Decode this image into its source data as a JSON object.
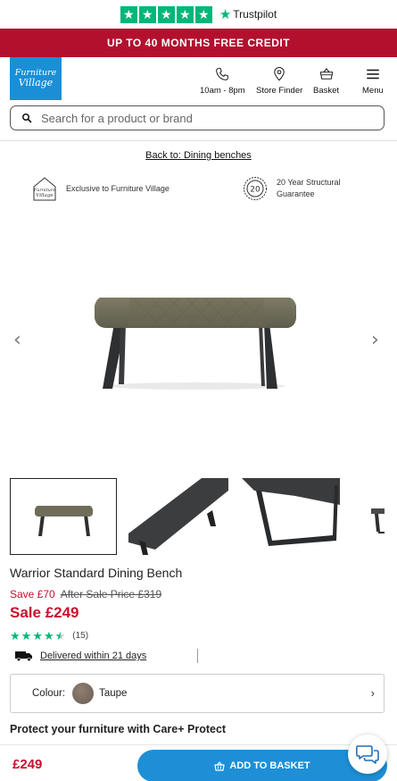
{
  "trustpilot": {
    "brand": "Trustpilot",
    "stars": [
      "★",
      "★",
      "★",
      "★",
      "★"
    ]
  },
  "promo": {
    "text": "UP TO 40 MONTHS FREE CREDIT"
  },
  "header": {
    "logo_line1": "Furniture",
    "logo_line2": "Village",
    "nav": {
      "hours": "10am - 8pm",
      "store_finder": "Store Finder",
      "basket": "Basket",
      "menu": "Menu"
    }
  },
  "search": {
    "placeholder": "Search for a product or brand"
  },
  "breadcrumb": {
    "back_label": "Back to: Dining benches"
  },
  "features": {
    "exclusive": "Exclusive to Furniture Village",
    "guarantee_line1": "20 Year Structural",
    "guarantee_line2": "Guarantee",
    "guarantee_badge": "20",
    "exclusive_icon_line1": "Furniture",
    "exclusive_icon_line2": "Village"
  },
  "gallery": {
    "prev": "‹",
    "next": "›"
  },
  "product": {
    "title": "Warrior Standard Dining Bench",
    "save_label": "Save £70",
    "after_sale_label": "After Sale Price £319",
    "sale_price_label": "Sale £249",
    "rating_value": 4.5,
    "review_count": "(15)",
    "delivery": "Delivered within 21 days",
    "colour_label": "Colour:",
    "colour_value": "Taupe",
    "care_heading": "Protect your furniture with Care+ Protect"
  },
  "sticky": {
    "price": "£249",
    "add_to_basket": "ADD TO BASKET"
  },
  "colors": {
    "brand_blue": "#1e8fd6",
    "promo_red": "#b3102e",
    "sale_red": "#c8102e",
    "trustpilot_green": "#00b67a"
  }
}
